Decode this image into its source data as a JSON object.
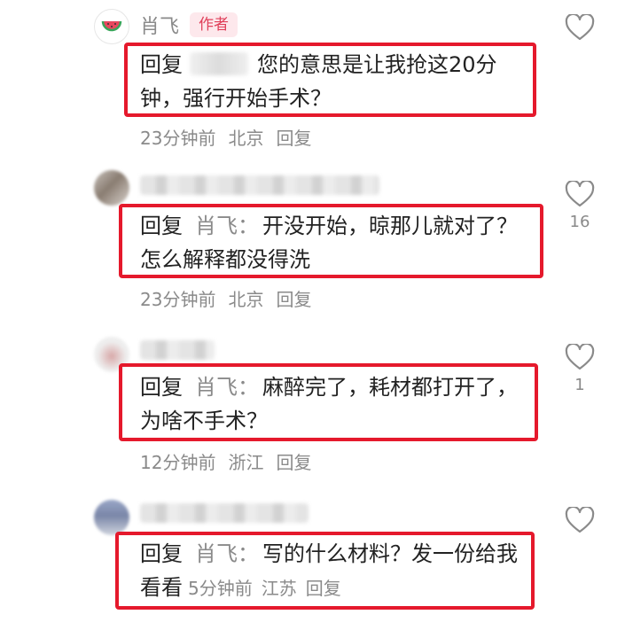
{
  "comments": [
    {
      "author": "肖飞",
      "badge": "作者",
      "reply_prefix": "回复",
      "text": "您的意思是让我抢这20分钟，强行开始手术？",
      "time": "23分钟前",
      "location": "北京",
      "reply_label": "回复",
      "likes": ""
    },
    {
      "reply_prefix": "回复",
      "reply_to": "肖飞：",
      "text": "开没开始，晾那儿就对了？怎么解释都没得洗",
      "time": "23分钟前",
      "location": "北京",
      "reply_label": "回复",
      "likes": "16"
    },
    {
      "reply_prefix": "回复",
      "reply_to": "肖飞：",
      "text": "麻醉完了，耗材都打开了，为啥不手术？",
      "time": "12分钟前",
      "location": "浙江",
      "reply_label": "回复",
      "likes": "1"
    },
    {
      "reply_prefix": "回复",
      "reply_to": "肖飞：",
      "text": "写的什么材料？发一份给我看看",
      "time": "5分钟前",
      "location": "江苏",
      "reply_label": "回复",
      "likes": ""
    }
  ],
  "icons": {
    "like": "heart-outline-icon",
    "author_avatar": "watermelon-icon"
  },
  "colors": {
    "highlight_border": "#e5192c",
    "badge_text": "#e0405a",
    "badge_bg": "#fde8ec",
    "muted": "#8a8a8a"
  }
}
